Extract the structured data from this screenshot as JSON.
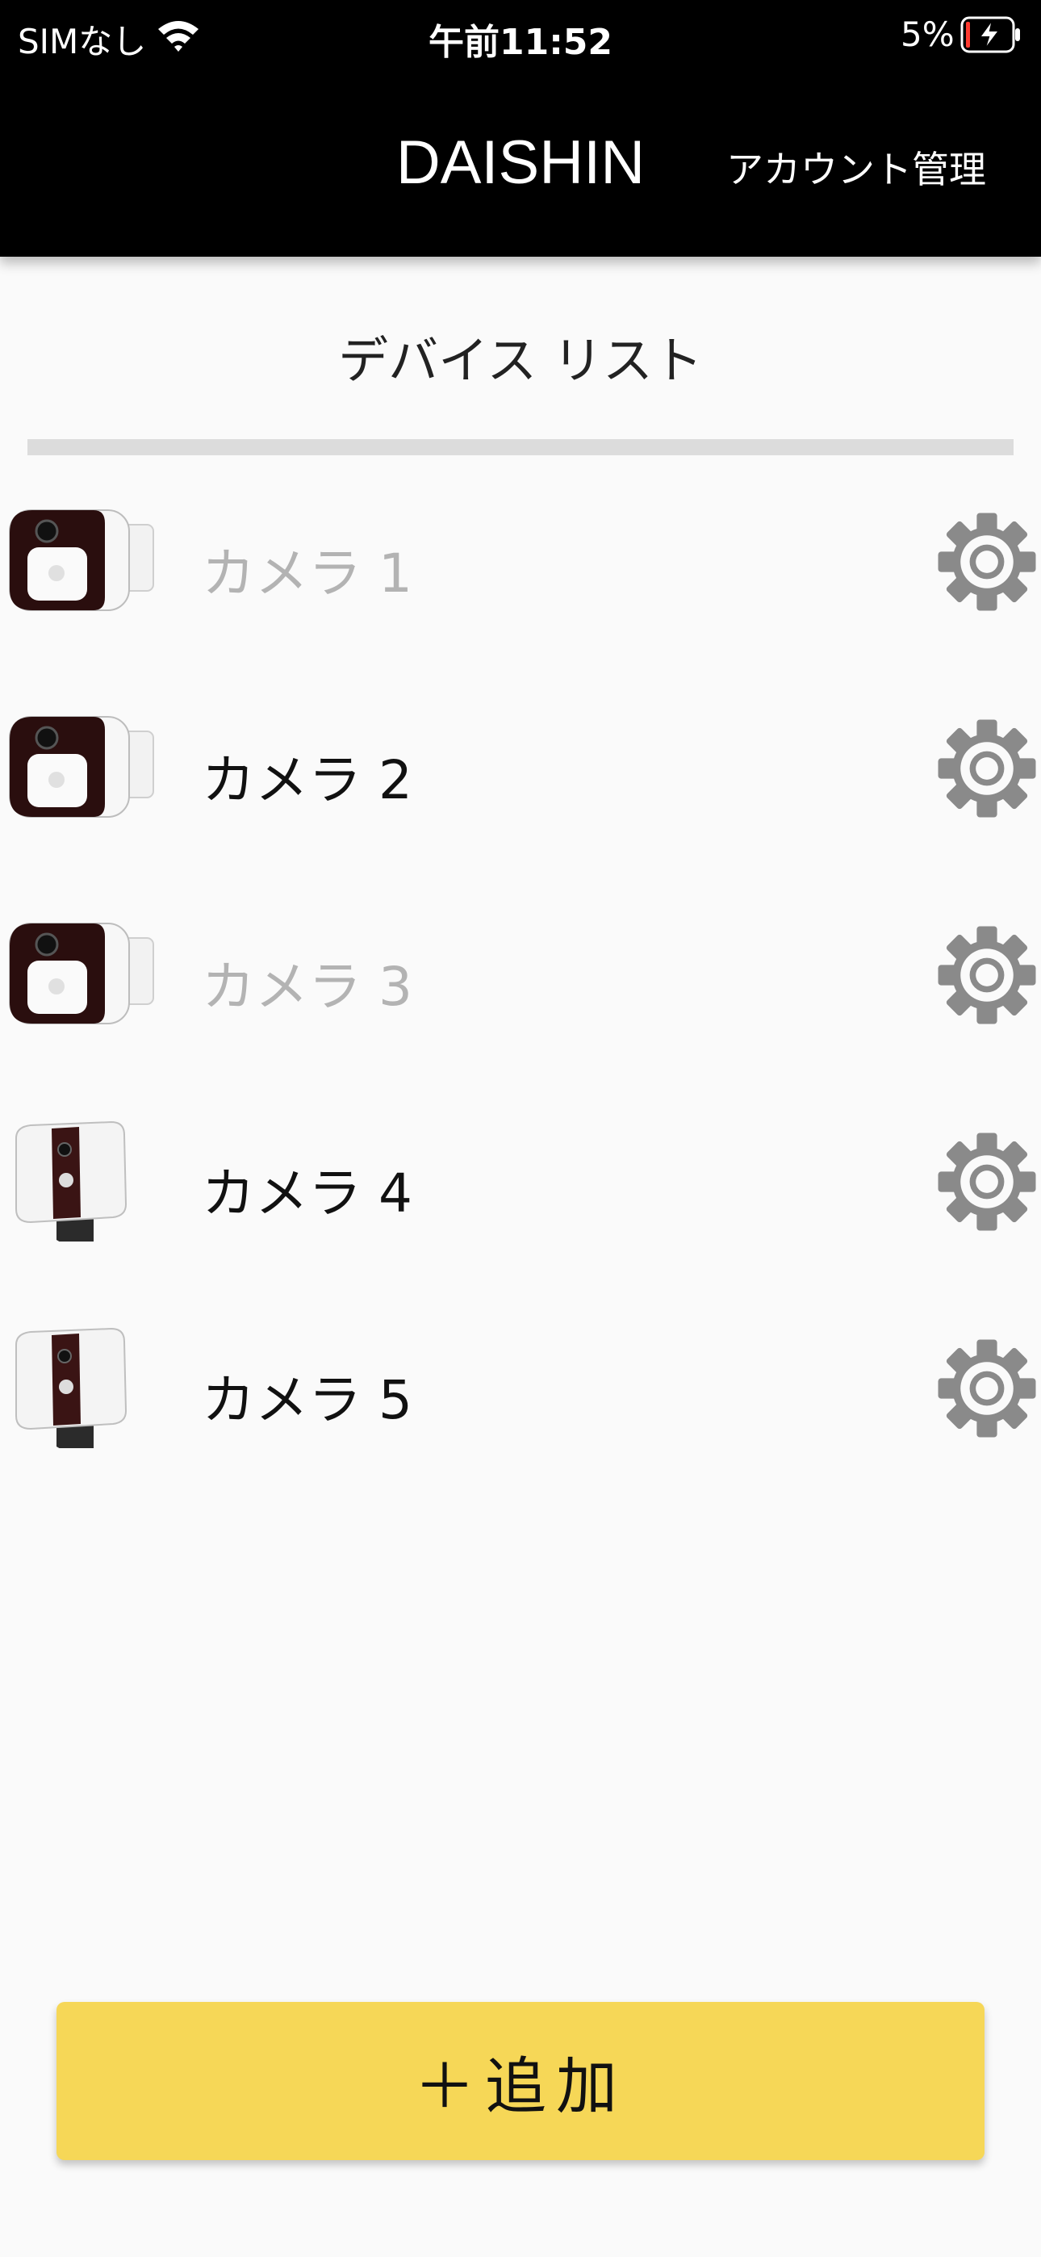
{
  "status_bar": {
    "carrier": "SIMなし",
    "time": "午前11:52",
    "battery_percent": "5%",
    "battery_level": 0.05
  },
  "header": {
    "title": "DAISHIN",
    "account_button": "アカウント管理"
  },
  "section_title": "デバイス リスト",
  "devices": [
    {
      "name": "カメラ 1",
      "status": "offline",
      "model": "box-camera"
    },
    {
      "name": "カメラ 2",
      "status": "online",
      "model": "box-camera"
    },
    {
      "name": "カメラ 3",
      "status": "offline",
      "model": "box-camera"
    },
    {
      "name": "カメラ 4",
      "status": "online",
      "model": "floodlight-camera"
    },
    {
      "name": "カメラ 5",
      "status": "online",
      "model": "floodlight-camera"
    }
  ],
  "add_button": "＋追加",
  "colors": {
    "header_bg": "#000000",
    "accent": "#f6d757",
    "gear": "#8a8a8a",
    "offline_text": "#b3b3b3"
  }
}
